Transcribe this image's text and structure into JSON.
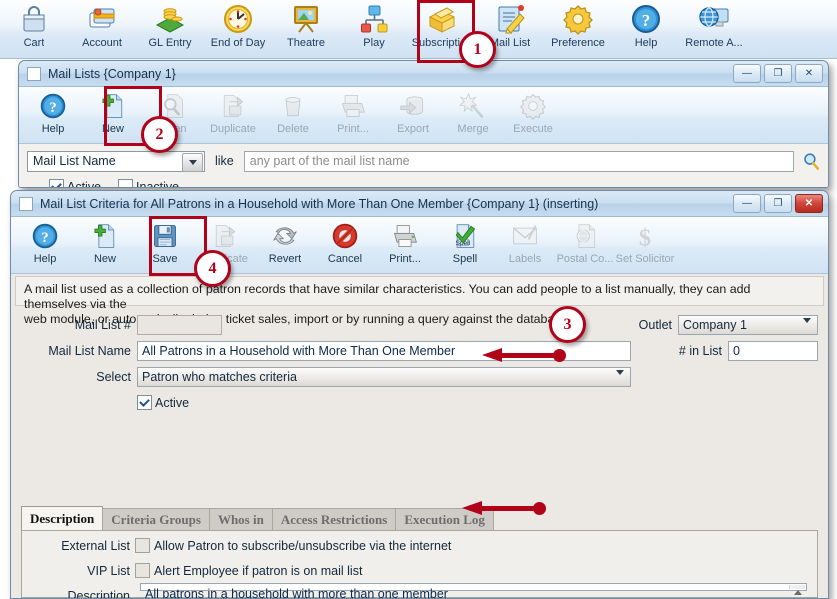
{
  "app_toolbar": {
    "buttons": [
      {
        "label": "Cart",
        "icon": "cart-icon"
      },
      {
        "label": "Account",
        "icon": "account-icon"
      },
      {
        "label": "GL Entry",
        "icon": "gl-entry-icon"
      },
      {
        "label": "End of Day",
        "icon": "end-of-day-icon"
      },
      {
        "label": "Theatre",
        "icon": "theatre-icon"
      },
      {
        "label": "Play",
        "icon": "play-icon"
      },
      {
        "label": "Subscription",
        "icon": "subscription-icon"
      },
      {
        "label": "Mail List",
        "icon": "mail-list-icon"
      },
      {
        "label": "Preference",
        "icon": "preference-icon"
      },
      {
        "label": "Help",
        "icon": "help-icon"
      },
      {
        "label": "Remote A...",
        "icon": "remote-access-icon"
      }
    ]
  },
  "window1": {
    "title": "Mail Lists {Company 1}",
    "controls": {
      "minimize": "—",
      "restore": "❐",
      "close": "✕"
    },
    "toolbar": [
      {
        "label": "Help",
        "icon": "help-icon",
        "disabled": false
      },
      {
        "label": "New",
        "icon": "new-icon",
        "disabled": false
      },
      {
        "label": "Open",
        "icon": "open-icon",
        "disabled": true
      },
      {
        "label": "Duplicate",
        "icon": "duplicate-icon",
        "disabled": true
      },
      {
        "label": "Delete",
        "icon": "delete-icon",
        "disabled": true
      },
      {
        "label": "Print...",
        "icon": "print-icon",
        "disabled": true
      },
      {
        "label": "Export",
        "icon": "export-icon",
        "disabled": true
      },
      {
        "label": "Merge",
        "icon": "merge-icon",
        "disabled": true
      },
      {
        "label": "Execute",
        "icon": "execute-icon",
        "disabled": true
      }
    ],
    "search": {
      "field_selected": "Mail List Name",
      "operator": "like",
      "value_placeholder": "any part of the mail list name",
      "search_icon": "magnifier-icon"
    },
    "filters": [
      {
        "label": "Active",
        "checked": true
      },
      {
        "label": "Inactive",
        "checked": false
      }
    ]
  },
  "window2": {
    "title": "Mail List Criteria for All Patrons in a Household with More Than One Member {Company 1} (inserting)",
    "controls": {
      "minimize": "—",
      "restore": "❐",
      "close": "✕"
    },
    "toolbar": [
      {
        "label": "Help",
        "icon": "help-icon",
        "disabled": false
      },
      {
        "label": "New",
        "icon": "new-icon",
        "disabled": false
      },
      {
        "label": "Save",
        "icon": "save-icon",
        "disabled": false
      },
      {
        "label": "Duplicate",
        "icon": "duplicate-icon",
        "disabled": true
      },
      {
        "label": "Revert",
        "icon": "revert-icon",
        "disabled": false
      },
      {
        "label": "Cancel",
        "icon": "cancel-icon",
        "disabled": false
      },
      {
        "label": "Print...",
        "icon": "print-icon",
        "disabled": false
      },
      {
        "label": "Spell",
        "icon": "spell-icon",
        "disabled": false
      },
      {
        "label": "Labels",
        "icon": "labels-icon",
        "disabled": true
      },
      {
        "label": "Postal Co...",
        "icon": "postal-code-icon",
        "disabled": true
      },
      {
        "label": "Set Solicitor",
        "icon": "set-solicitor-icon",
        "disabled": true
      }
    ],
    "blurb_line1": "A mail list used as a collection of patron records that have similar characteristics.   You can add people to a list manually, they can add themselves via the",
    "blurb_line2": "web module, or automatically during ticket sales, import or by running a query against the database.",
    "fields": {
      "mail_list_number_label": "Mail List #",
      "mail_list_number_value": "",
      "mail_list_name_label": "Mail List Name",
      "mail_list_name_value": "All Patrons in a Household with More Than One Member",
      "select_label": "Select",
      "select_value": "Patron who matches criteria",
      "active_label": "Active",
      "active_checked": true,
      "outlet_label": "Outlet",
      "outlet_value": "Company 1",
      "in_list_label": "# in List",
      "in_list_value": "0"
    },
    "tabs": [
      {
        "label": "Description",
        "active": true
      },
      {
        "label": "Criteria Groups",
        "active": false
      },
      {
        "label": "Whos in",
        "active": false
      },
      {
        "label": "Access Restrictions",
        "active": false
      },
      {
        "label": "Execution Log",
        "active": false
      }
    ],
    "description_tab": {
      "external_list_label": "External List",
      "external_list_caption": "Allow Patron to subscribe/unsubscribe via the internet",
      "external_list_checked": false,
      "vip_list_label": "VIP List",
      "vip_list_caption": "Alert Employee if patron is on mail list",
      "vip_list_checked": false,
      "description_label": "Description",
      "description_value": "All patrons in a household with more than one member"
    }
  },
  "annotations": {
    "callouts": [
      {
        "number": "1"
      },
      {
        "number": "2"
      },
      {
        "number": "3"
      },
      {
        "number": "4"
      }
    ],
    "accent_color": "#b1021a"
  }
}
